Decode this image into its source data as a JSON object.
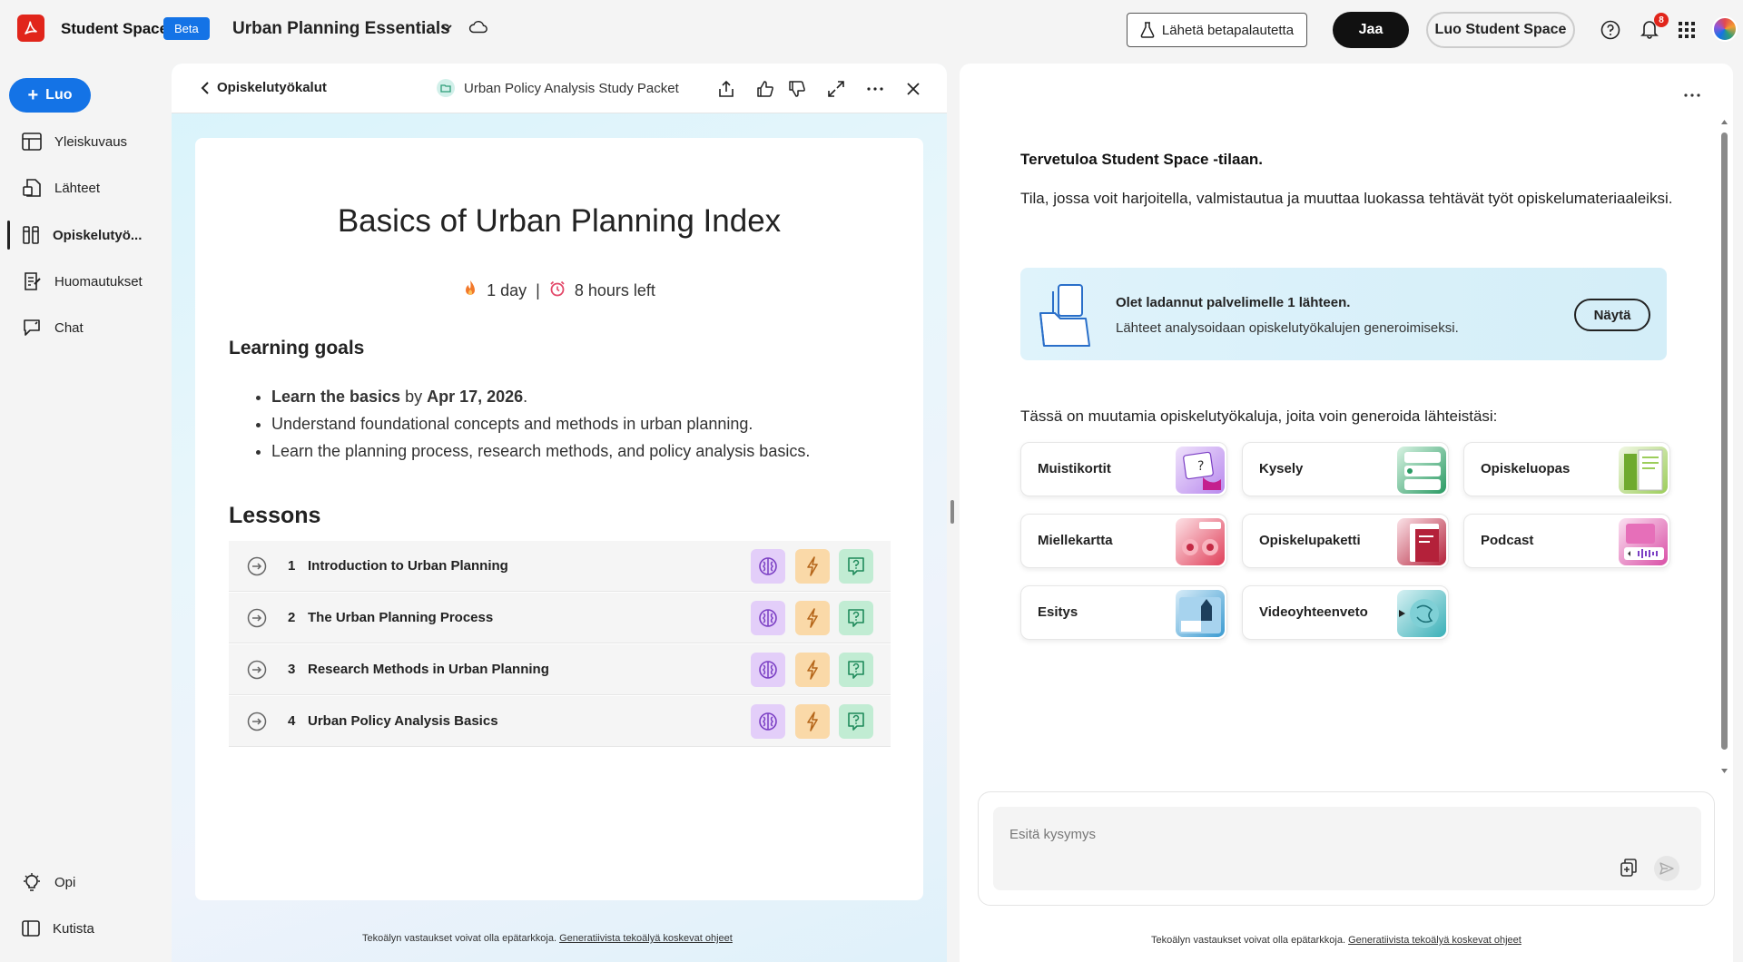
{
  "topbar": {
    "brand": "Student Spaces",
    "beta": "Beta",
    "doc_title": "Urban Planning Essentials",
    "feedback_label": "Lähetä betapalautetta",
    "share_label": "Jaa",
    "create_space_label": "Luo Student Space",
    "notification_count": "8"
  },
  "nav": {
    "create_label": "Luo",
    "items": [
      {
        "label": "Yleiskuvaus",
        "icon": "layout-icon"
      },
      {
        "label": "Lähteet",
        "icon": "sources-icon"
      },
      {
        "label": "Opiskelutyö...",
        "icon": "study-tools-icon"
      },
      {
        "label": "Huomautukset",
        "icon": "notes-icon"
      },
      {
        "label": "Chat",
        "icon": "chat-icon"
      }
    ],
    "bottom": [
      {
        "label": "Opi",
        "icon": "lightbulb-icon"
      },
      {
        "label": "Kutista",
        "icon": "collapse-icon"
      }
    ]
  },
  "center": {
    "back_label": "Opiskelutyökalut",
    "packet_label": "Urban Policy Analysis Study Packet",
    "title": "Basics of Urban Planning Index",
    "streak": "1 day",
    "separator": "|",
    "time_left": "8 hours left",
    "goals_heading": "Learning goals",
    "goal1_bold": "Learn the basics",
    "goal1_mid": " by ",
    "goal1_date": "Apr 17, 2026",
    "goal1_end": ".",
    "goal2": "Understand foundational concepts and methods in urban planning.",
    "goal3": "Learn the planning process, research methods, and policy analysis basics.",
    "lessons_heading": "Lessons",
    "lessons": [
      {
        "num": "1",
        "title": "Introduction to Urban Planning"
      },
      {
        "num": "2",
        "title": "The Urban Planning Process"
      },
      {
        "num": "3",
        "title": "Research Methods in Urban Planning"
      },
      {
        "num": "4",
        "title": "Urban Policy Analysis Basics"
      }
    ],
    "disclaimer": "Tekoälyn vastaukset voivat olla epätarkkoja.",
    "disclaimer_link": "Generatiivista tekoälyä koskevat ohjeet"
  },
  "right": {
    "welcome": "Tervetuloa Student Space -tilaan.",
    "intro": "Tila, jossa voit harjoitella, valmistautua ja muuttaa luokassa tehtävät työt opiskelumateriaaleiksi.",
    "banner_title": "Olet ladannut palvelimelle 1 lähteen.",
    "banner_text": "Lähteet analysoidaan opiskelutyökalujen generoimiseksi.",
    "banner_button": "Näytä",
    "tools_lead": "Tässä on muutamia opiskelutyökaluja, joita voin generoida lähteistäsi:",
    "tools": [
      {
        "label": "Muistikortit",
        "color": "#9c4fd8"
      },
      {
        "label": "Kysely",
        "color": "#1f8a5b"
      },
      {
        "label": "Opiskeluopas",
        "color": "#7fb83a"
      },
      {
        "label": "Miellekartta",
        "color": "#e0405a"
      },
      {
        "label": "Opiskelupaketti",
        "color": "#b4213a"
      },
      {
        "label": "Podcast",
        "color": "#d94fa6"
      },
      {
        "label": "Esitys",
        "color": "#3b9bd1"
      },
      {
        "label": "Videoyhteenveto",
        "color": "#3ab0b8"
      }
    ],
    "ask_placeholder": "Esitä kysymys",
    "disclaimer": "Tekoälyn vastaukset voivat olla epätarkkoja.",
    "disclaimer_link": "Generatiivista tekoälyä koskevat ohjeet"
  },
  "colors": {
    "accent_blue": "#1473e6",
    "brand_red": "#e1251b"
  }
}
